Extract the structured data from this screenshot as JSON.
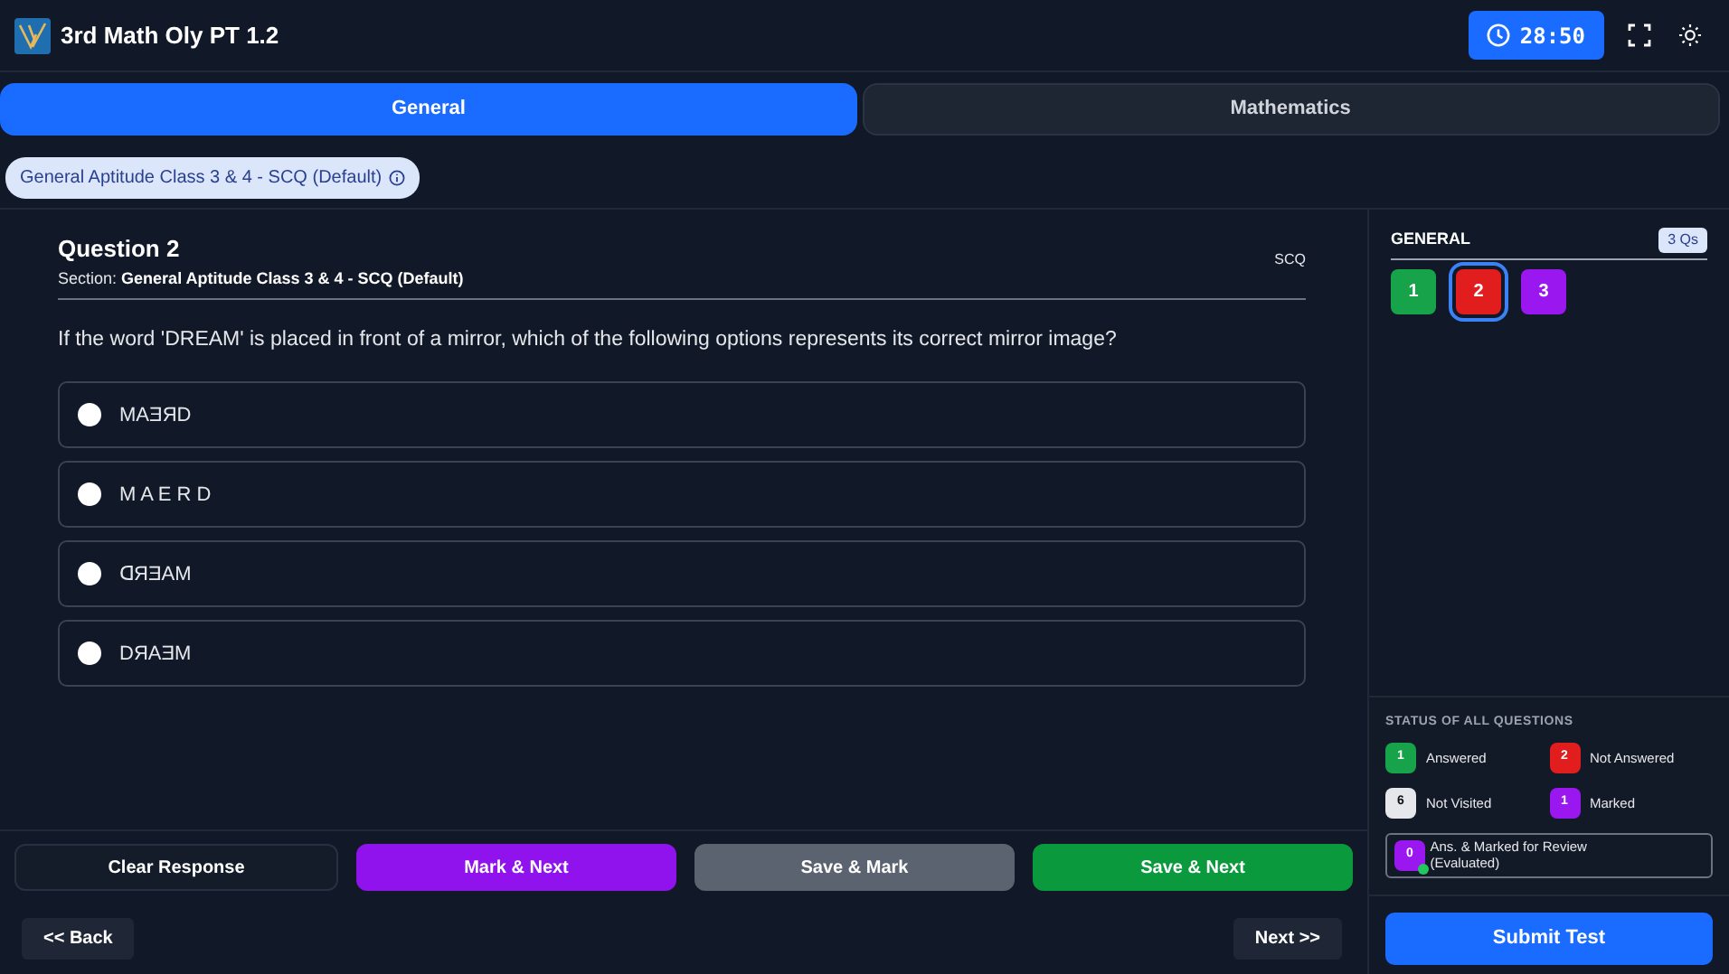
{
  "header": {
    "title": "3rd Math Oly PT 1.2",
    "timer": "28:50"
  },
  "tabs": [
    {
      "label": "General",
      "selected": true
    },
    {
      "label": "Mathematics",
      "selected": false
    }
  ],
  "section_chip": "General Aptitude Class 3 & 4 - SCQ (Default)",
  "question": {
    "title": "Question 2",
    "section_label": "Section:",
    "section_name": "General Aptitude Class 3 & 4 - SCQ (Default)",
    "type": "SCQ",
    "text": "If the word 'DREAM' is placed in front of a mirror, which of the following options represents its correct mirror image?",
    "options": [
      {
        "text": "MAƎЯD",
        "selected": false
      },
      {
        "text": "M A E R D",
        "selected": false
      },
      {
        "text": "ᗡЯƎAM",
        "selected": false
      },
      {
        "text": "DЯAƎM",
        "selected": false
      }
    ]
  },
  "actions": [
    {
      "label": "Clear Response",
      "kind": "outline"
    },
    {
      "label": "Mark & Next",
      "kind": "purple"
    },
    {
      "label": "Save & Mark",
      "kind": "grey"
    },
    {
      "label": "Save & Next",
      "kind": "green"
    }
  ],
  "nav": {
    "back": "<< Back",
    "next": "Next >>"
  },
  "palette": {
    "title": "GENERAL",
    "count": "3 Qs",
    "questions": [
      {
        "number": "1",
        "color": "#16a34a",
        "selected": false
      },
      {
        "number": "2",
        "color": "#e11d1d",
        "selected": true
      },
      {
        "number": "3",
        "color": "#9b17f0",
        "selected": false
      }
    ]
  },
  "legend": {
    "title": "STATUS OF ALL QUESTIONS",
    "items": [
      {
        "count": "1",
        "label": "Answered",
        "color": "#16a34a"
      },
      {
        "count": "2",
        "label": "Not Answered",
        "color": "#e11d1d"
      },
      {
        "count": "6",
        "label": "Not Visited",
        "color": "#e5e7eb"
      },
      {
        "count": "1",
        "label": "Marked",
        "color": "#9b17f0"
      }
    ],
    "review": {
      "count": "0",
      "label": "Ans. & Marked for Review",
      "sublabel": "(Evaluated)",
      "color": "#9b17f0"
    }
  },
  "submit": "Submit Test"
}
